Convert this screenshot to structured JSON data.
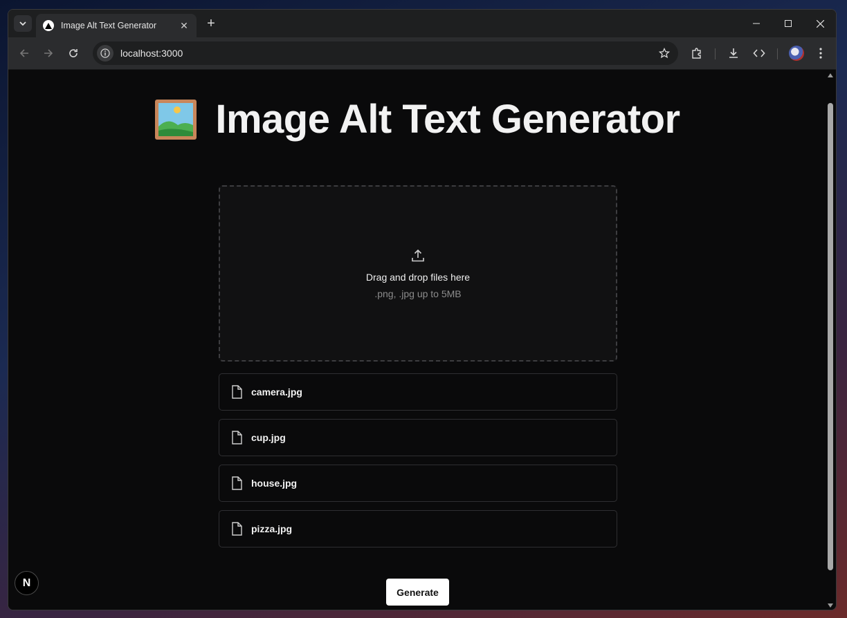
{
  "browser": {
    "tab_title": "Image Alt Text Generator",
    "tab_close": "✕",
    "new_tab": "+",
    "url": "localhost:3000"
  },
  "page": {
    "title": "Image Alt Text Generator",
    "title_icon": "framed-picture-emoji",
    "dropzone": {
      "text": "Drag and drop files here",
      "subtext": ".png, .jpg up to 5MB",
      "icon": "upload-icon"
    },
    "files": [
      {
        "name": "camera.jpg"
      },
      {
        "name": "cup.jpg"
      },
      {
        "name": "house.jpg"
      },
      {
        "name": "pizza.jpg"
      }
    ],
    "generate_label": "Generate",
    "next_badge": "N"
  },
  "colors": {
    "background": "#0a0a0b",
    "button_bg": "#ffffff",
    "border": "#2f2f32"
  }
}
